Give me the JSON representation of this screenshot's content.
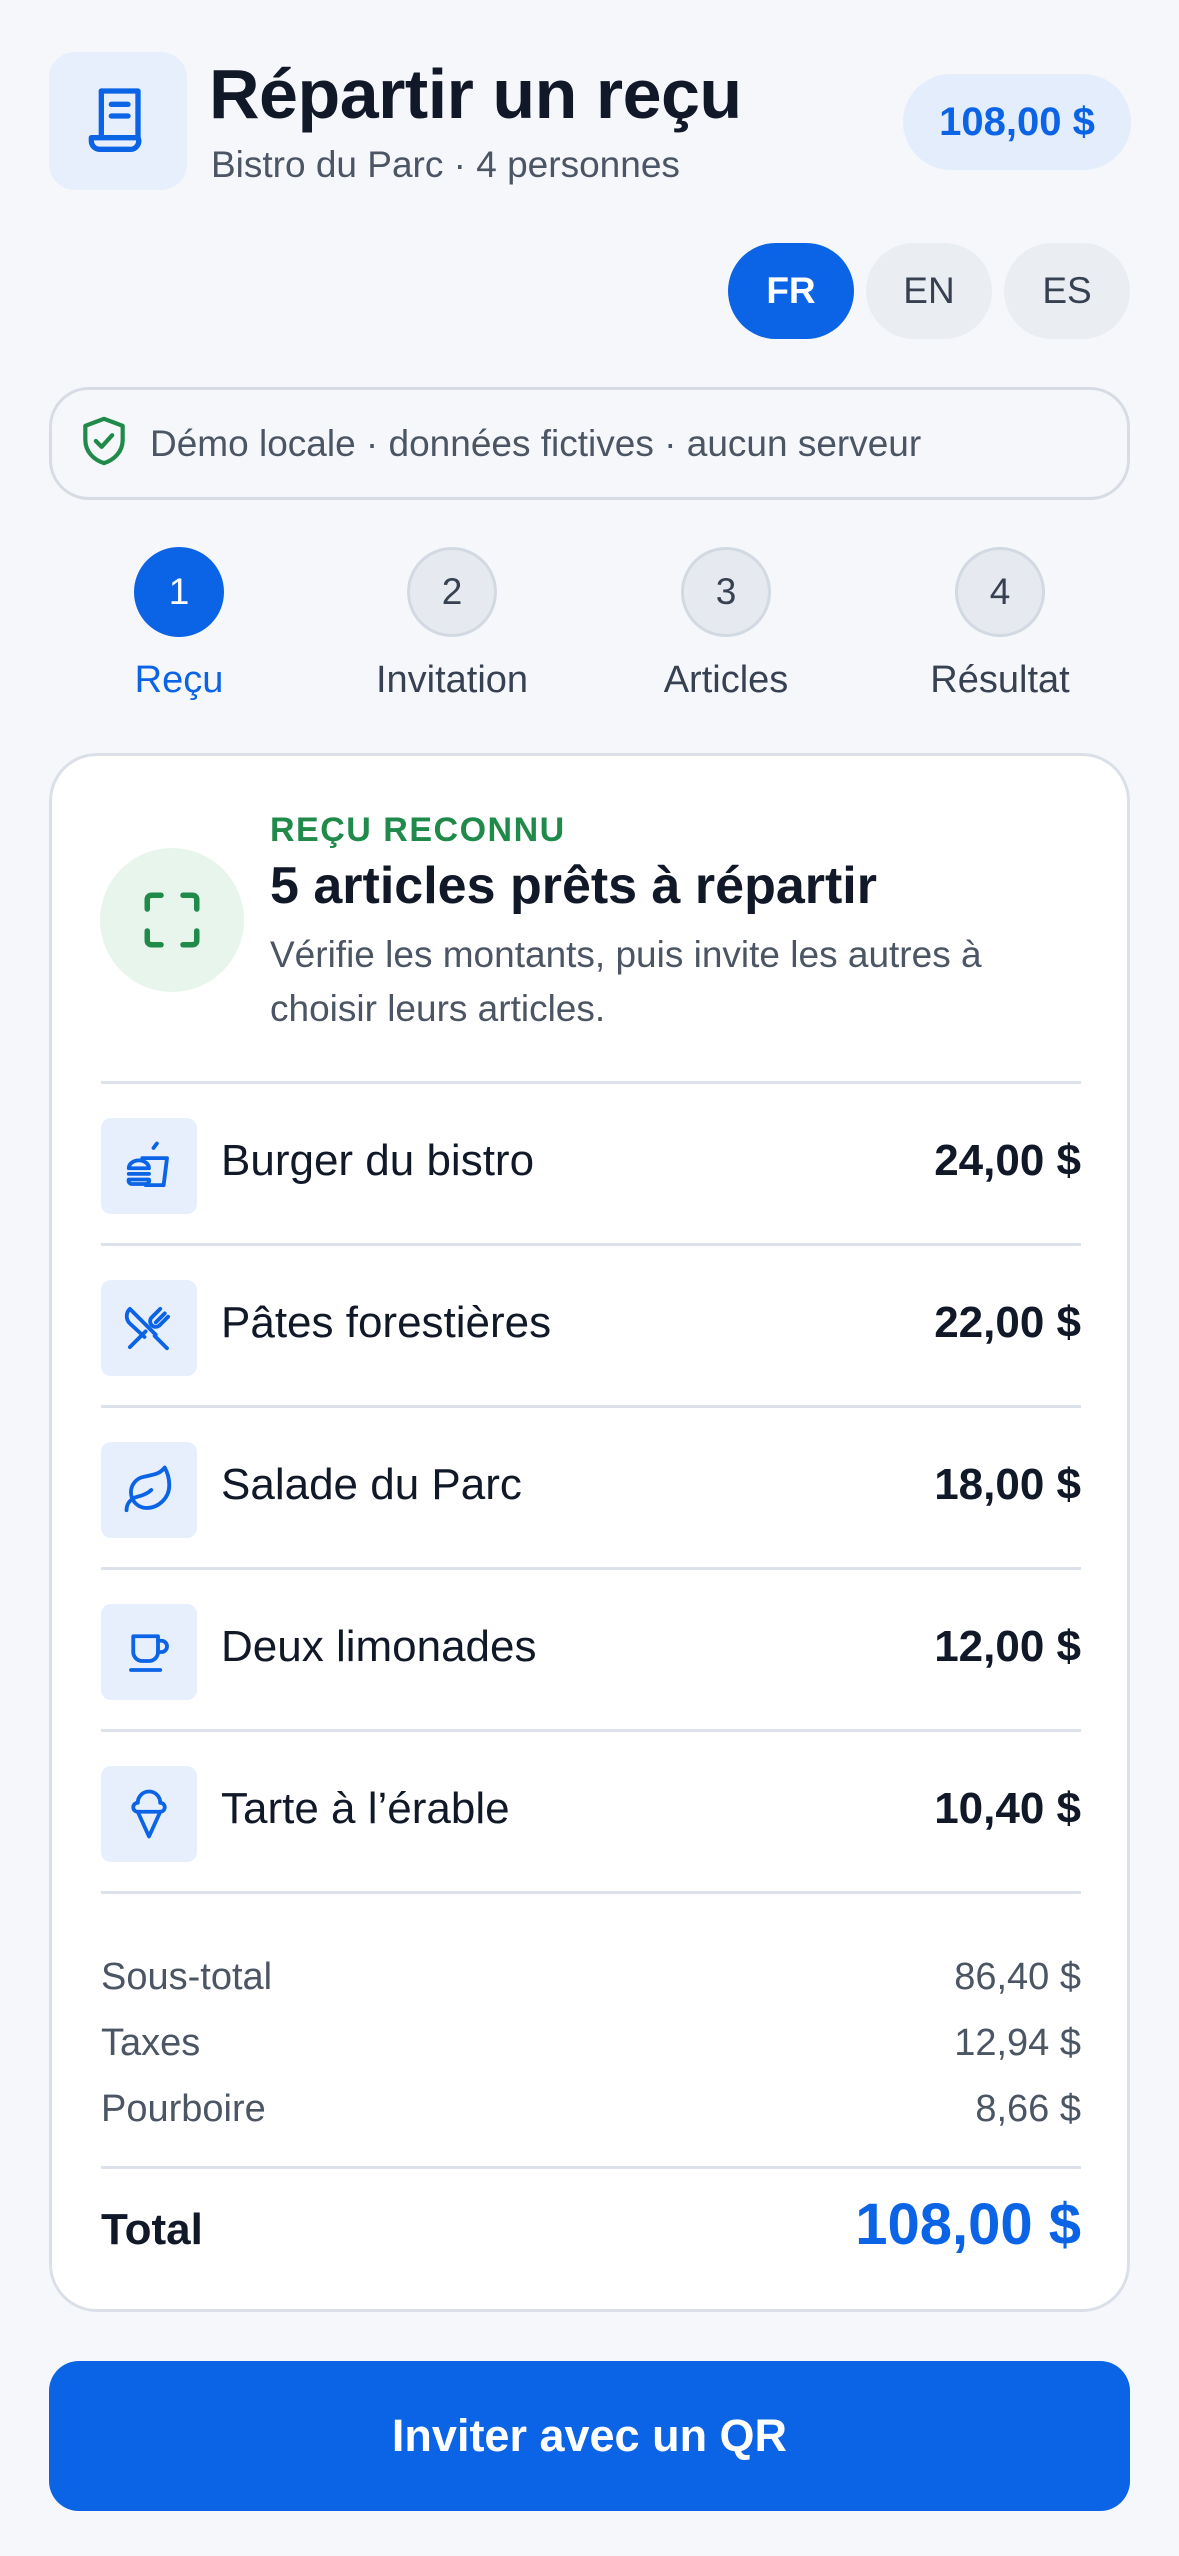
{
  "header": {
    "title": "Répartir un reçu",
    "subtitle": "Bistro du Parc · 4 personnes",
    "total": "108,00 $",
    "icon": "receipt-icon"
  },
  "languages": [
    {
      "code": "FR",
      "active": true
    },
    {
      "code": "EN",
      "active": false
    },
    {
      "code": "ES",
      "active": false
    }
  ],
  "banner": {
    "icon": "shield-check-icon",
    "text": "Démo locale · données fictives · aucun serveur"
  },
  "steps": [
    {
      "number": "1",
      "label": "Reçu",
      "active": true
    },
    {
      "number": "2",
      "label": "Invitation",
      "active": false
    },
    {
      "number": "3",
      "label": "Articles",
      "active": false
    },
    {
      "number": "4",
      "label": "Résultat",
      "active": false
    }
  ],
  "card": {
    "status_label": "REÇU RECONNU",
    "title": "5 articles prêts à répartir",
    "description": "Vérifie les montants, puis invite les autres à choisir leurs articles.",
    "items": [
      {
        "name": "Burger du bistro",
        "price": "24,00 $",
        "icon": "burger-icon"
      },
      {
        "name": "Pâtes forestières",
        "price": "22,00 $",
        "icon": "utensils-icon"
      },
      {
        "name": "Salade du Parc",
        "price": "18,00 $",
        "icon": "leaf-icon"
      },
      {
        "name": "Deux limonades",
        "price": "12,00 $",
        "icon": "cup-icon"
      },
      {
        "name": "Tarte à l’érable",
        "price": "10,40 $",
        "icon": "ice-cream-icon"
      }
    ],
    "summary": {
      "subtotal_label": "Sous-total",
      "subtotal": "86,40 $",
      "taxes_label": "Taxes",
      "taxes": "12,94 $",
      "tip_label": "Pourboire",
      "tip": "8,66 $",
      "total_label": "Total",
      "total": "108,00 $"
    }
  },
  "cta": {
    "label": "Inviter avec un QR"
  },
  "colors": {
    "accent": "#0b63e5",
    "success": "#1f8a4a",
    "background": "#f5f7fb"
  }
}
